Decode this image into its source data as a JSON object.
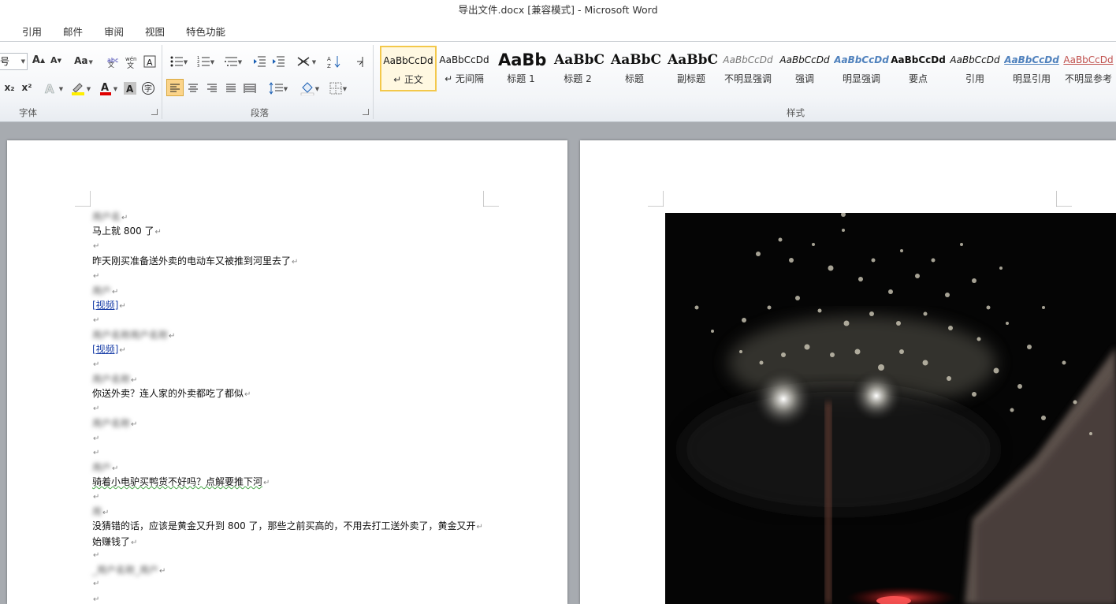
{
  "window": {
    "title": "导出文件.docx [兼容模式] - Microsoft Word"
  },
  "ribbon_tabs": [
    "引用",
    "邮件",
    "审阅",
    "视图",
    "特色功能"
  ],
  "font_group": {
    "label": "字体",
    "font_size_fragment": "号",
    "change_case": "Aa",
    "grow_font": "A",
    "shrink_font": "A",
    "subscript": "x₂",
    "superscript": "x²",
    "char_shading": "A"
  },
  "paragraph_group": {
    "label": "段落"
  },
  "styles_group": {
    "label": "样式",
    "items": [
      {
        "sample": "AaBbCcDd",
        "name": "↵ 正文"
      },
      {
        "sample": "AaBbCcDd",
        "name": "↵ 无间隔"
      },
      {
        "sample": "AaBb",
        "name": "标题 1"
      },
      {
        "sample": "AaBbC",
        "name": "标题 2"
      },
      {
        "sample": "AaBbC",
        "name": "标题"
      },
      {
        "sample": "AaBbC",
        "name": "副标题"
      },
      {
        "sample": "AaBbCcDd",
        "name": "不明显强调"
      },
      {
        "sample": "AaBbCcDd",
        "name": "强调"
      },
      {
        "sample": "AaBbCcDd",
        "name": "明显强调"
      },
      {
        "sample": "AaBbCcDd",
        "name": "要点"
      },
      {
        "sample": "AaBbCcDd",
        "name": "引用"
      },
      {
        "sample": "AaBbCcDd",
        "name": "明显引用"
      },
      {
        "sample": "AaBbCcDd",
        "name": "不明显参考"
      }
    ],
    "selected_index": 0
  },
  "document": {
    "paragraph_mark": "↵",
    "lines": [
      {
        "type": "redacted",
        "text": "用户名"
      },
      {
        "type": "text",
        "text": "马上就 800 了"
      },
      {
        "type": "empty"
      },
      {
        "type": "text",
        "text": "昨天刚买准备送外卖的电动车又被推到河里去了"
      },
      {
        "type": "empty"
      },
      {
        "type": "redacted",
        "text": "用户"
      },
      {
        "type": "link",
        "text": "[视频]"
      },
      {
        "type": "empty"
      },
      {
        "type": "redacted",
        "text": "用户名称用户名称"
      },
      {
        "type": "link",
        "text": "[视频]"
      },
      {
        "type": "empty"
      },
      {
        "type": "redacted",
        "text": "用户名称"
      },
      {
        "type": "text",
        "text": "你送外卖？连人家的外卖都吃了都似"
      },
      {
        "type": "empty"
      },
      {
        "type": "redacted",
        "text": "用户名称"
      },
      {
        "type": "empty"
      },
      {
        "type": "empty"
      },
      {
        "type": "redacted",
        "text": "用户"
      },
      {
        "type": "squiggle",
        "text": "骑着小电驴买鸭货不好吗？点解要推下河"
      },
      {
        "type": "empty"
      },
      {
        "type": "redacted",
        "text": "用"
      },
      {
        "type": "text",
        "text": "没猜错的话，应该是黄金又升到 800 了，那些之前买高的，不用去打工送外卖了，黄金又开"
      },
      {
        "type": "text",
        "text": "始赚钱了"
      },
      {
        "type": "empty"
      },
      {
        "type": "redacted",
        "text": "_用户名称_用户"
      },
      {
        "type": "empty"
      },
      {
        "type": "empty"
      }
    ]
  }
}
